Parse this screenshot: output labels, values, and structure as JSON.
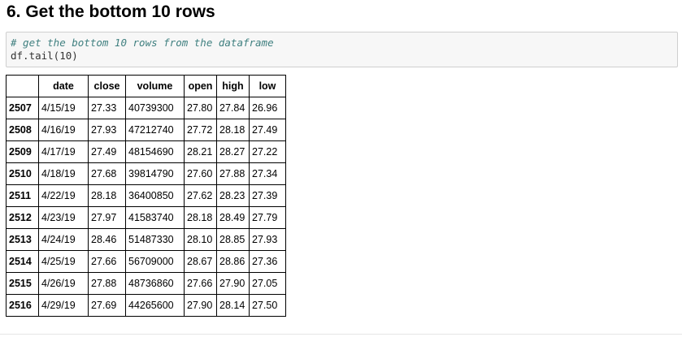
{
  "heading": "6. Get the bottom 10 rows",
  "code": {
    "comment": "# get the bottom 10 rows from the dataframe",
    "line": "df.tail(10)"
  },
  "table": {
    "columns": [
      "",
      "date",
      "close",
      "volume",
      "open",
      "high",
      "low"
    ],
    "rows": [
      {
        "index": "2507",
        "date": "4/15/19",
        "close": "27.33",
        "volume": "40739300",
        "open": "27.80",
        "high": "27.84",
        "low": "26.96"
      },
      {
        "index": "2508",
        "date": "4/16/19",
        "close": "27.93",
        "volume": "47212740",
        "open": "27.72",
        "high": "28.18",
        "low": "27.49"
      },
      {
        "index": "2509",
        "date": "4/17/19",
        "close": "27.49",
        "volume": "48154690",
        "open": "28.21",
        "high": "28.27",
        "low": "27.22"
      },
      {
        "index": "2510",
        "date": "4/18/19",
        "close": "27.68",
        "volume": "39814790",
        "open": "27.60",
        "high": "27.88",
        "low": "27.34"
      },
      {
        "index": "2511",
        "date": "4/22/19",
        "close": "28.18",
        "volume": "36400850",
        "open": "27.62",
        "high": "28.23",
        "low": "27.39"
      },
      {
        "index": "2512",
        "date": "4/23/19",
        "close": "27.97",
        "volume": "41583740",
        "open": "28.18",
        "high": "28.49",
        "low": "27.79"
      },
      {
        "index": "2513",
        "date": "4/24/19",
        "close": "28.46",
        "volume": "51487330",
        "open": "28.10",
        "high": "28.85",
        "low": "27.93"
      },
      {
        "index": "2514",
        "date": "4/25/19",
        "close": "27.66",
        "volume": "56709000",
        "open": "28.67",
        "high": "28.86",
        "low": "27.36"
      },
      {
        "index": "2515",
        "date": "4/26/19",
        "close": "27.88",
        "volume": "48736860",
        "open": "27.66",
        "high": "27.90",
        "low": "27.05"
      },
      {
        "index": "2516",
        "date": "4/29/19",
        "close": "27.69",
        "volume": "44265600",
        "open": "27.90",
        "high": "28.14",
        "low": "27.50"
      }
    ]
  }
}
